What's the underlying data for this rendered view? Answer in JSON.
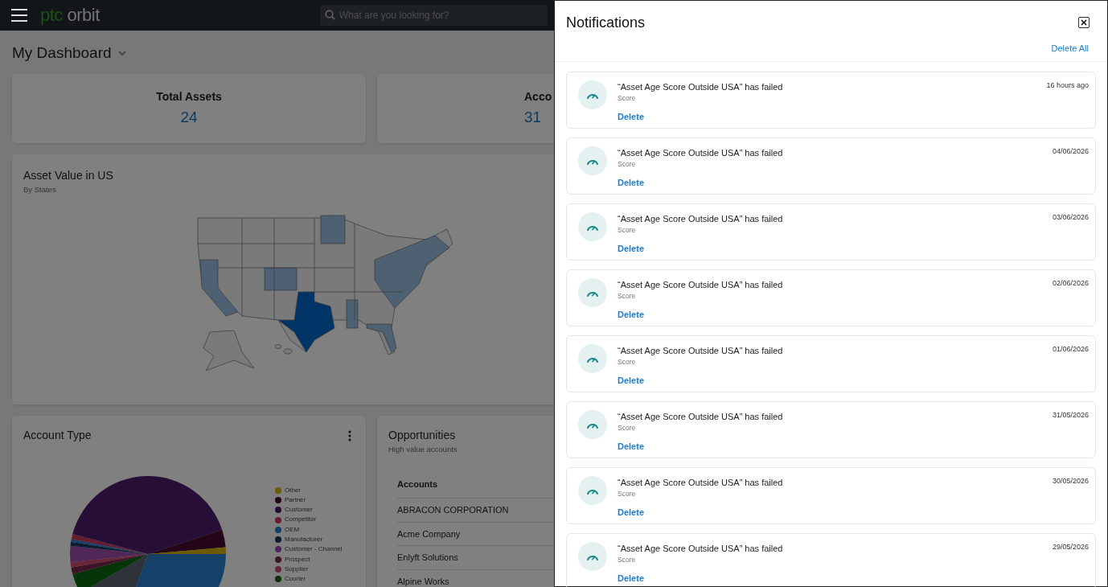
{
  "header": {
    "logo_prefix": "ptc",
    "logo_suffix": "orbit",
    "search": {
      "placeholder": "What are you looking for?"
    }
  },
  "dashboard": {
    "title": "My Dashboard",
    "stats": [
      {
        "label": "Total Assets",
        "value": "24"
      },
      {
        "label": "Acco",
        "value": "31"
      }
    ],
    "map_card": {
      "title": "Asset Value in US",
      "subtitle": "By States"
    },
    "account_type": {
      "title": "Account Type",
      "legend": [
        {
          "label": "Other",
          "color": "#6e5a00"
        },
        {
          "label": "Partner",
          "color": "#250618"
        },
        {
          "label": "Customer",
          "color": "#260e36"
        },
        {
          "label": "Competitor",
          "color": "#641e32"
        },
        {
          "label": "OEM",
          "color": "#154168"
        },
        {
          "label": "Manufacturer",
          "color": "#0d1d30"
        },
        {
          "label": "Customer - Channel",
          "color": "#502858"
        },
        {
          "label": "Prospect",
          "color": "#3d1528"
        },
        {
          "label": "Supplier",
          "color": "#682638"
        },
        {
          "label": "Courier",
          "color": "#053508"
        }
      ]
    },
    "opportunities": {
      "title": "Opportunities",
      "subtitle": "High value accounts",
      "column": "Accounts",
      "rows": [
        "ABRACON CORPORATION",
        "Acme Company",
        "Enlyft Solutions",
        "Alpine Works"
      ]
    }
  },
  "notifications": {
    "title": "Notifications",
    "delete_all": "Delete All",
    "items": [
      {
        "title": "“Asset Age Score Outside USA” has failed",
        "category": "Score",
        "action": "Delete",
        "time": "16 hours ago"
      },
      {
        "title": "“Asset Age Score Outside USA” has failed",
        "category": "Score",
        "action": "Delete",
        "time": "04/06/2026"
      },
      {
        "title": "“Asset Age Score Outside USA” has failed",
        "category": "Score",
        "action": "Delete",
        "time": "03/06/2026"
      },
      {
        "title": "“Asset Age Score Outside USA” has failed",
        "category": "Score",
        "action": "Delete",
        "time": "02/06/2026"
      },
      {
        "title": "“Asset Age Score Outside USA” has failed",
        "category": "Score",
        "action": "Delete",
        "time": "01/06/2026"
      },
      {
        "title": "“Asset Age Score Outside USA” has failed",
        "category": "Score",
        "action": "Delete",
        "time": "31/05/2026"
      },
      {
        "title": "“Asset Age Score Outside USA” has failed",
        "category": "Score",
        "action": "Delete",
        "time": "30/05/2026"
      },
      {
        "title": "“Asset Age Score Outside USA” has failed",
        "category": "Score",
        "action": "Delete",
        "time": "29/05/2026"
      }
    ]
  }
}
